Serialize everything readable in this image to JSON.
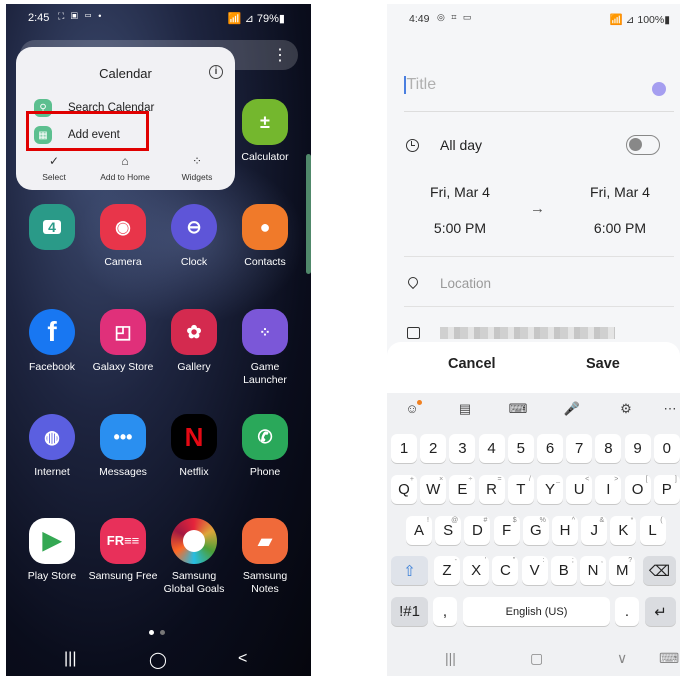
{
  "left_phone": {
    "status_bar": {
      "time": "2:45",
      "icons": "⛶ ▣ ▭ •",
      "right": "📶 ⊿ 79%▮"
    },
    "menu_icon": "⋮",
    "popup": {
      "title": "Calendar",
      "info_icon": "i",
      "items": [
        {
          "label": "Search Calendar",
          "icon": "search-icon"
        },
        {
          "label": "Add event",
          "icon": "calendar-add-icon"
        }
      ],
      "actions": [
        {
          "label": "Select",
          "glyph": "✓"
        },
        {
          "label": "Add to Home",
          "glyph": "⌂"
        },
        {
          "label": "Widgets",
          "glyph": "⁘"
        }
      ]
    },
    "apps": {
      "calculator": "Calculator",
      "calendar_day": "4",
      "camera": "Camera",
      "clock": "Clock",
      "contacts": "Contacts",
      "facebook": "Facebook",
      "galaxy_store": "Galaxy Store",
      "gallery": "Gallery",
      "game_launcher": "Game Launcher",
      "internet": "Internet",
      "messages": "Messages",
      "netflix": "Netflix",
      "phone": "Phone",
      "play_store": "Play Store",
      "samsung_free": "Samsung Free",
      "samsung_free_logo": "FR≡≡",
      "global_goals": "Samsung Global Goals",
      "samsung_notes": "Samsung Notes"
    },
    "nav": {
      "recents": "|||",
      "home": "◯",
      "back": "<"
    },
    "colors": {
      "highlight": "#e00000"
    }
  },
  "right_phone": {
    "status_bar": {
      "time": "4:49",
      "icons": "◎ ⌗ ▭",
      "right": "📶 ⊿ 100%▮"
    },
    "title_placeholder": "Title",
    "all_day_label": "All day",
    "start_date": "Fri, Mar 4",
    "start_time": "5:00 PM",
    "end_date": "Fri, Mar 4",
    "end_time": "6:00 PM",
    "arrow": "→",
    "location_placeholder": "Location",
    "cancel_label": "Cancel",
    "save_label": "Save",
    "keyboard": {
      "toolbar": [
        "☺",
        "▤",
        "⌨",
        "🎤",
        "⚙",
        "⋯"
      ],
      "numbers": [
        "1",
        "2",
        "3",
        "4",
        "5",
        "6",
        "7",
        "8",
        "9",
        "0"
      ],
      "row1": [
        "Q",
        "W",
        "E",
        "R",
        "T",
        "Y",
        "U",
        "I",
        "O",
        "P"
      ],
      "row1_sub": [
        "+",
        "×",
        "÷",
        "=",
        "/",
        "_",
        "<",
        ">",
        "[",
        "]"
      ],
      "row2": [
        "A",
        "S",
        "D",
        "F",
        "G",
        "H",
        "J",
        "K",
        "L"
      ],
      "row2_sub": [
        "!",
        "@",
        "#",
        "$",
        "%",
        "^",
        "&",
        "*",
        "("
      ],
      "row3": [
        "Z",
        "X",
        "C",
        "V",
        "B",
        "N",
        "M"
      ],
      "row3_sub": [
        "-",
        "'",
        "\"",
        ":",
        ";",
        ",",
        "?"
      ],
      "shift": "⇧",
      "backspace": "⌫",
      "symbols": "!#1",
      "comma": ",",
      "space": "English (US)",
      "period": ".",
      "enter": "↵"
    },
    "nav": {
      "recents": "|||",
      "home": "▢",
      "back": "∨",
      "keyboard": "⌨"
    }
  }
}
